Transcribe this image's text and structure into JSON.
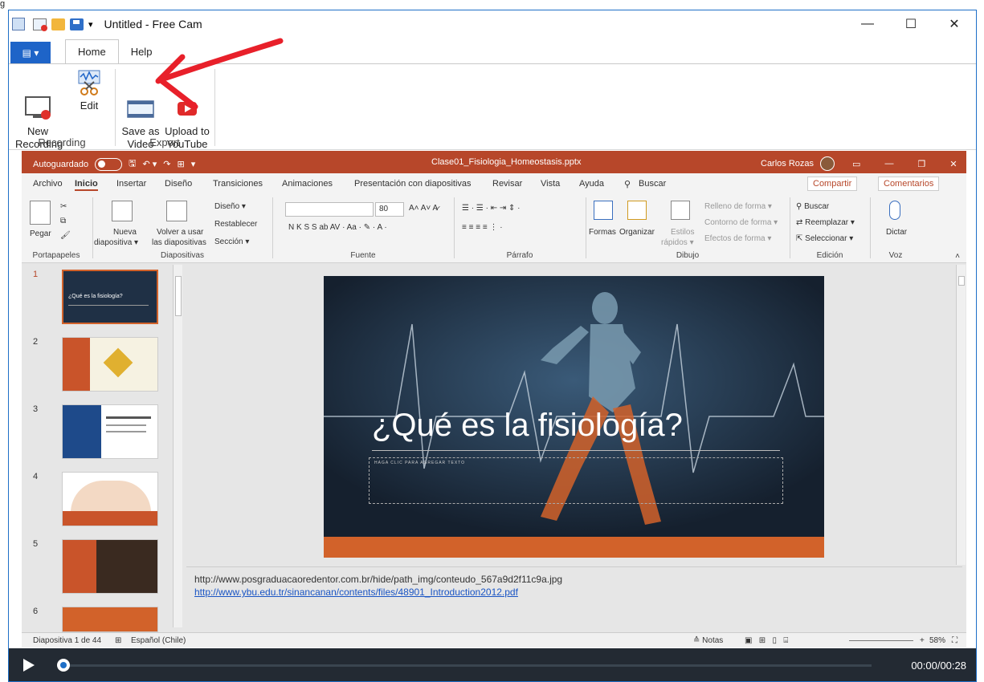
{
  "outer_corner": "g",
  "app": {
    "title": "Untitled - Free Cam"
  },
  "window_controls": {
    "minimize": "—",
    "maximize": "☐",
    "close": "✕"
  },
  "tabs": {
    "file_icon": "▤ ▾",
    "items": [
      {
        "label": "Home"
      },
      {
        "label": "Help"
      }
    ]
  },
  "ribbon": {
    "groups": [
      {
        "label": "Recording",
        "buttons": [
          {
            "label": "New\nRecording"
          },
          {
            "label": "Edit"
          }
        ]
      },
      {
        "label": "Export",
        "buttons": [
          {
            "label": "Save as\nVideo"
          },
          {
            "label": "Upload to\nYouTube"
          }
        ]
      }
    ]
  },
  "ppt": {
    "autosave": "Autoguardado",
    "filename": "Clase01_Fisiologia_Homeostasis.pptx",
    "user": "Carlos Rozas",
    "tabs": [
      "Archivo",
      "Inicio",
      "Insertar",
      "Diseño",
      "Transiciones",
      "Animaciones",
      "Presentación con diapositivas",
      "Revisar",
      "Vista",
      "Ayuda",
      "Buscar"
    ],
    "share": "Compartir",
    "comments": "Comentarios",
    "ribbon": {
      "groups": [
        "Portapapeles",
        "Diapositivas",
        "Fuente",
        "Párrafo",
        "Dibujo",
        "Edición",
        "Voz"
      ],
      "pegar": "Pegar",
      "nueva": "Nueva",
      "nueva2": "diapositiva ▾",
      "volver": "Volver a usar",
      "volver2": "las diapositivas",
      "diseno": "Diseño ▾",
      "restablecer": "Restablecer",
      "seccion": "Sección ▾",
      "font_size": "80",
      "formas": "Formas",
      "organizar": "Organizar",
      "estilos": "Estilos",
      "estilos2": "rápidos ▾",
      "relleno": "Relleno de forma ▾",
      "contorno": "Contorno de forma ▾",
      "efectos": "Efectos de forma ▾",
      "buscar": "Buscar",
      "reemplazar": "Reemplazar ▾",
      "seleccionar": "Seleccionar ▾",
      "dictar": "Dictar"
    },
    "thumbs": [
      {
        "n": "1",
        "text": "¿Qué es la fisiología?"
      },
      {
        "n": "2"
      },
      {
        "n": "3"
      },
      {
        "n": "4"
      },
      {
        "n": "5"
      },
      {
        "n": "6"
      }
    ],
    "slide": {
      "title": "¿Qué es la fisiología?",
      "subtitle": "HAGA CLIC PARA AGREGAR TEXTO"
    },
    "notes": [
      "http://www.posgraduacaoredentor.com.br/hide/path_img/conteudo_567a9d2f11c9a.jpg",
      "http://www.ybu.edu.tr/sinancanan/contents/files/48901_Introduction2012.pdf"
    ],
    "status": {
      "slide": "Diapositiva 1 de 44",
      "lang": "Español (Chile)",
      "notes": "≙ Notas",
      "zoom": "58%"
    }
  },
  "player": {
    "time": "00:00/00:28",
    "progress": 0
  },
  "colors": {
    "accent": "#1e64c8",
    "ppt": "#b7472a",
    "arrow": "#e8202a"
  }
}
